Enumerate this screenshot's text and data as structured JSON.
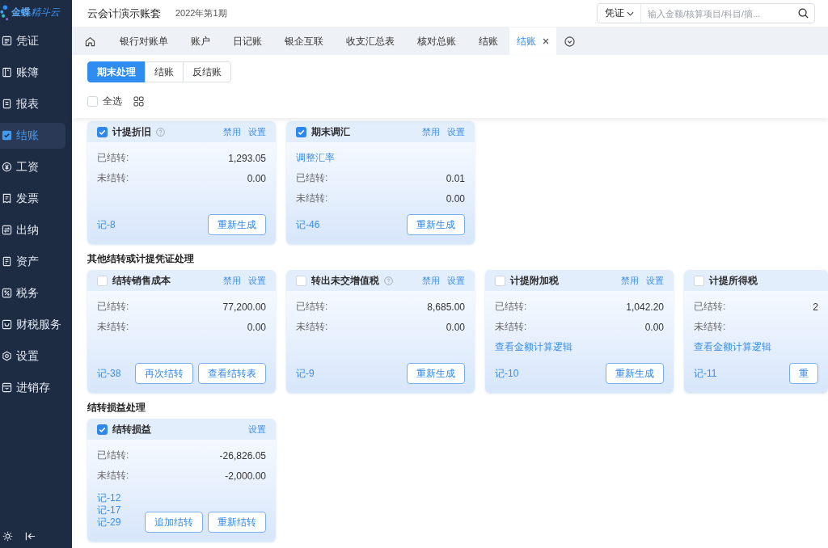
{
  "sidebar": {
    "logo": {
      "brand": "金蝶",
      "product": "精斗云"
    },
    "items": [
      {
        "label": "凭证",
        "selected": false
      },
      {
        "label": "账簿",
        "selected": false
      },
      {
        "label": "报表",
        "selected": false
      },
      {
        "label": "结账",
        "selected": true
      },
      {
        "label": "工资",
        "selected": false
      },
      {
        "label": "发票",
        "selected": false
      },
      {
        "label": "出纳",
        "selected": false
      },
      {
        "label": "资产",
        "selected": false
      },
      {
        "label": "税务",
        "selected": false
      },
      {
        "label": "财税服务",
        "selected": false
      },
      {
        "label": "设置",
        "selected": false
      },
      {
        "label": "进销存",
        "selected": false
      }
    ]
  },
  "header": {
    "account": "云会计演示账套",
    "period": "2022年第1期",
    "search": {
      "type": "凭证",
      "placeholder": "输入金额/核算项目/科目/摘..."
    }
  },
  "tabs": [
    {
      "label": "银行对账单",
      "selected": false
    },
    {
      "label": "账户",
      "selected": false
    },
    {
      "label": "日记账",
      "selected": false
    },
    {
      "label": "银企互联",
      "selected": false
    },
    {
      "label": "收支汇总表",
      "selected": false
    },
    {
      "label": "核对总账",
      "selected": false
    },
    {
      "label": "结账",
      "selected": false
    },
    {
      "label": "结账",
      "selected": true
    }
  ],
  "toolbar": {
    "modes": [
      {
        "label": "期末处理",
        "selected": true
      },
      {
        "label": "结账",
        "selected": false
      },
      {
        "label": "反结账",
        "selected": false
      }
    ],
    "select_all": {
      "label": "全选",
      "checked": false
    }
  },
  "sections": [
    {
      "cards": [
        {
          "title": "计提折旧",
          "checked": true,
          "help": true,
          "actions": [
            "禁用",
            "设置"
          ],
          "lines": [
            {
              "kind": "amount",
              "label": "已结转:",
              "value": "1,293.05"
            },
            {
              "kind": "amount",
              "label": "未结转:",
              "value": "0.00"
            }
          ],
          "vouchers": [
            "记-8"
          ],
          "buttons": [
            "重新生成"
          ]
        },
        {
          "title": "期末调汇",
          "checked": true,
          "help": false,
          "actions": [
            "禁用",
            "设置"
          ],
          "lines": [
            {
              "kind": "link",
              "text": "调整汇率"
            },
            {
              "kind": "amount",
              "label": "已结转:",
              "value": "0.01"
            },
            {
              "kind": "amount",
              "label": "未结转:",
              "value": "0.00"
            }
          ],
          "vouchers": [
            "记-46"
          ],
          "buttons": [
            "重新生成"
          ]
        }
      ]
    },
    {
      "title": "其他结转或计提凭证处理",
      "cards": [
        {
          "title": "结转销售成本",
          "checked": false,
          "help": false,
          "actions": [
            "禁用",
            "设置"
          ],
          "lines": [
            {
              "kind": "amount",
              "label": "已结转:",
              "value": "77,200.00"
            },
            {
              "kind": "amount",
              "label": "未结转:",
              "value": "0.00"
            }
          ],
          "vouchers": [
            "记-38"
          ],
          "buttons": [
            "再次结转",
            "查看结转表"
          ]
        },
        {
          "title": "转出未交增值税",
          "checked": false,
          "help": true,
          "actions": [
            "禁用",
            "设置"
          ],
          "lines": [
            {
              "kind": "amount",
              "label": "已结转:",
              "value": "8,685.00"
            },
            {
              "kind": "amount",
              "label": "未结转:",
              "value": "0.00"
            }
          ],
          "vouchers": [
            "记-9"
          ],
          "buttons": [
            "重新生成"
          ]
        },
        {
          "title": "计提附加税",
          "checked": false,
          "help": false,
          "actions": [
            "禁用",
            "设置"
          ],
          "lines": [
            {
              "kind": "amount",
              "label": "已结转:",
              "value": "1,042.20"
            },
            {
              "kind": "amount",
              "label": "未结转:",
              "value": "0.00"
            },
            {
              "kind": "link",
              "text": "查看金额计算逻辑"
            }
          ],
          "vouchers": [
            "记-10"
          ],
          "buttons": [
            "重新生成"
          ]
        },
        {
          "title": "计提所得税",
          "checked": false,
          "help": false,
          "lines": [
            {
              "kind": "amount",
              "label": "已结转:",
              "value": "2"
            },
            {
              "kind": "amount",
              "label": "未结转:"
            },
            {
              "kind": "link",
              "text": "查看金额计算逻辑"
            }
          ],
          "vouchers": [
            "记-11"
          ],
          "buttons": [
            "重"
          ]
        }
      ]
    },
    {
      "title": "结转损益处理",
      "cards": [
        {
          "title": "结转损益",
          "checked": true,
          "help": false,
          "actions": [
            "设置"
          ],
          "lines": [
            {
              "kind": "amount",
              "label": "已结转:",
              "value": "-26,826.05"
            },
            {
              "kind": "amount",
              "label": "未结转:",
              "value": "-2,000.00"
            }
          ],
          "vouchers": [
            "记-12",
            "记-17",
            "记-29"
          ],
          "buttons": [
            "追加结转",
            "重新结转"
          ]
        }
      ]
    }
  ]
}
